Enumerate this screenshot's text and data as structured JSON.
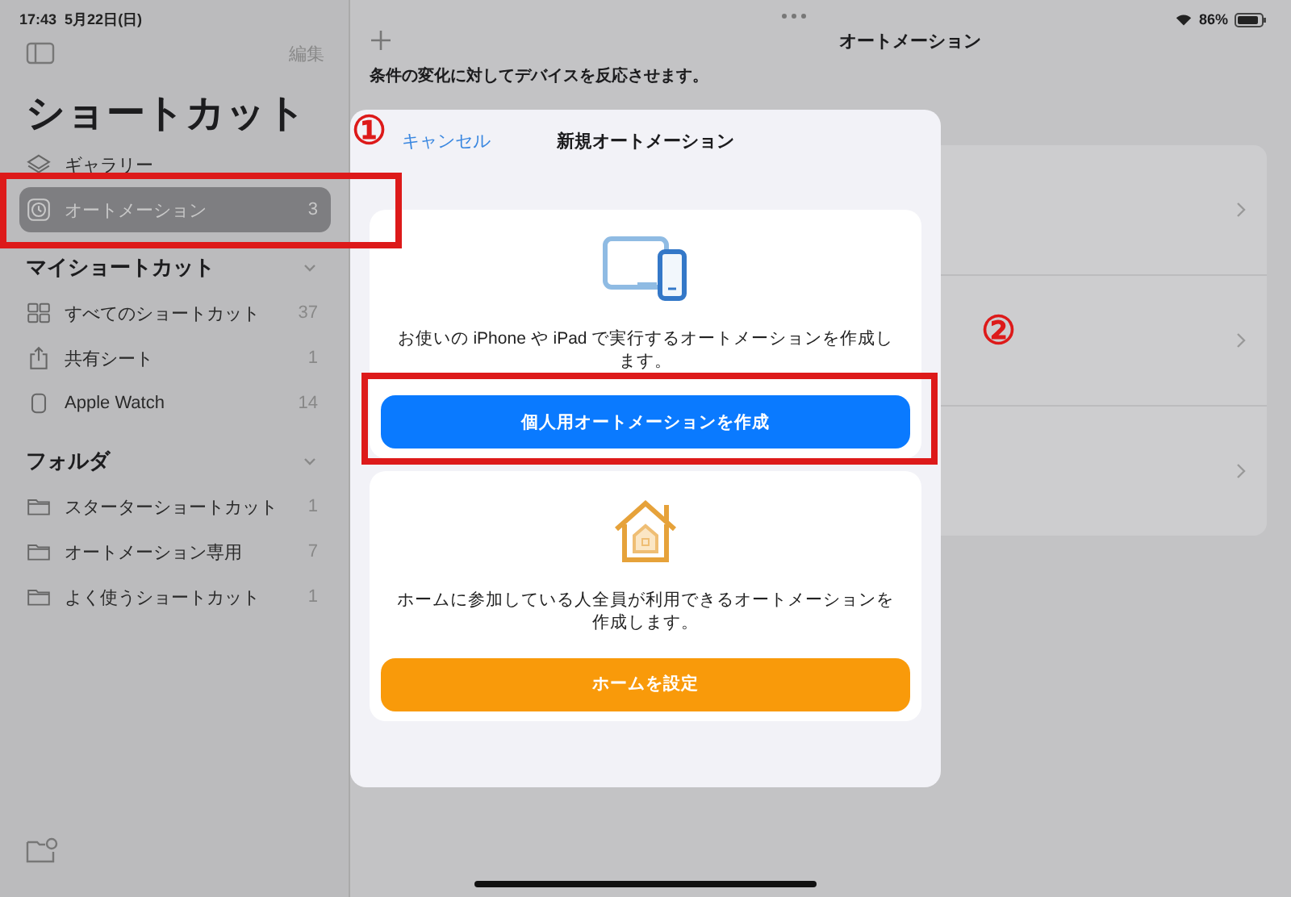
{
  "status_bar": {
    "time": "17:43",
    "date": "5月22日(日)",
    "battery": "86%"
  },
  "sidebar": {
    "edit": "編集",
    "title": "ショートカット",
    "items": [
      {
        "label": "ギャラリー",
        "kind": "gallery",
        "selected": false
      },
      {
        "label": "オートメーション",
        "count": "3",
        "kind": "automation",
        "selected": true
      }
    ],
    "sections": [
      {
        "title": "マイショートカット",
        "expanded": true,
        "items": [
          {
            "label": "すべてのショートカット",
            "count": "37",
            "kind": "grid"
          },
          {
            "label": "共有シート",
            "count": "1",
            "kind": "share"
          },
          {
            "label": "Apple Watch",
            "count": "14",
            "kind": "watch"
          }
        ]
      },
      {
        "title": "フォルダ",
        "expanded": true,
        "items": [
          {
            "label": "スターターショートカット",
            "count": "1",
            "kind": "folder"
          },
          {
            "label": "オートメーション専用",
            "count": "7",
            "kind": "folder"
          },
          {
            "label": "よく使うショートカット",
            "count": "1",
            "kind": "folder"
          }
        ]
      }
    ]
  },
  "main": {
    "title": "オートメーション",
    "subtitle": "条件の変化に対してデバイスを反応させます。"
  },
  "modal": {
    "cancel": "キャンセル",
    "title": "新規オートメーション",
    "cards": [
      {
        "kind": "device",
        "description": "お使いの iPhone や iPad で実行するオートメーションを作成します。",
        "button": "個人用オートメーションを作成"
      },
      {
        "kind": "home",
        "description": "ホームに参加している人全員が利用できるオートメーションを作成します。",
        "button": "ホームを設定"
      }
    ]
  },
  "annotations": [
    {
      "label": "①"
    },
    {
      "label": "②"
    }
  ]
}
